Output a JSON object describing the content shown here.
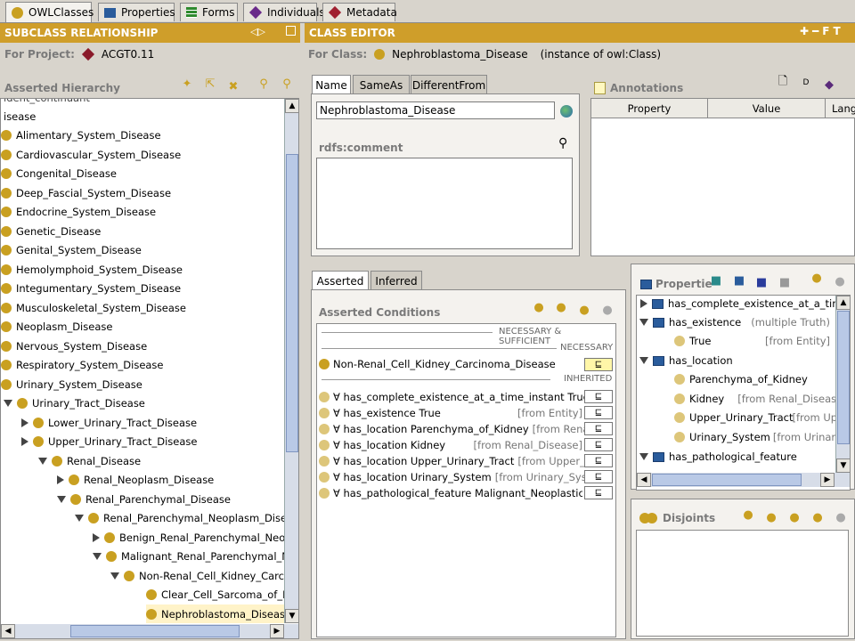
{
  "top_tabs": [
    {
      "label": "OWLClasses",
      "icon": "owl-classes-icon"
    },
    {
      "label": "Properties",
      "icon": "properties-icon"
    },
    {
      "label": "Forms",
      "icon": "forms-icon"
    },
    {
      "label": "Individuals",
      "icon": "individuals-icon"
    },
    {
      "label": "Metadata",
      "icon": "metadata-icon"
    }
  ],
  "left": {
    "header": "SUBCLASS RELATIONSHIP",
    "for_project_label": "For Project:",
    "project_name": "ACGT0.11",
    "hierarchy_label": "Asserted Hierarchy",
    "tree": [
      "isease",
      "Alimentary_System_Disease",
      "Cardiovascular_System_Disease",
      "Congenital_Disease",
      "Deep_Fascial_System_Disease",
      "Endocrine_System_Disease",
      "Genetic_Disease",
      "Genital_System_Disease",
      "Hemolymphoid_System_Disease",
      "Integumentary_System_Disease",
      "Musculoskeletal_System_Disease",
      "Neoplasm_Disease",
      "Nervous_System_Disease",
      "Respiratory_System_Disease",
      "Urinary_System_Disease",
      "Urinary_Tract_Disease",
      "Lower_Urinary_Tract_Disease",
      "Upper_Urinary_Tract_Disease",
      "Renal_Disease",
      "Renal_Neoplasm_Disease",
      "Renal_Parenchymal_Disease",
      "Renal_Parenchymal_Neoplasm_Disease",
      "Benign_Renal_Parenchymal_Neopla",
      "Malignant_Renal_Parenchymal_Neop",
      "Non-Renal_Cell_Kidney_Carcino",
      "Clear_Cell_Sarcoma_of_Kid",
      "Nephroblastoma_Disease"
    ]
  },
  "editor": {
    "header": "CLASS EDITOR",
    "for_class_label": "For Class:",
    "class_name": "Nephroblastoma_Disease",
    "instance_of": "(instance of owl:Class)",
    "name_tabs": [
      "Name",
      "SameAs",
      "DifferentFrom"
    ],
    "name_value": "Nephroblastoma_Disease",
    "rdfs_comment_label": "rdfs:comment",
    "annotations_label": "Annotations",
    "annotation_columns": [
      "Property",
      "Value",
      "Lang"
    ],
    "cond_tabs": [
      "Asserted",
      "Inferred"
    ],
    "asserted_conditions_label": "Asserted Conditions",
    "nec_suff_label": "NECESSARY & SUFFICIENT",
    "necessary_label": "NECESSARY",
    "necessary_item": "Non-Renal_Cell_Kidney_Carcinoma_Disease",
    "inherited_label": "INHERITED",
    "subclass_symbol": "⊑",
    "inherited": [
      {
        "text": "∀ has_complete_existence_at_a_time_instant True",
        "from": ""
      },
      {
        "text": "∀ has_existence True",
        "from": "[from Entity]"
      },
      {
        "text": "∀ has_location Parenchyma_of_Kidney",
        "from": "[from Renal...]"
      },
      {
        "text": "∀ has_location Kidney",
        "from": "[from Renal_Disease]"
      },
      {
        "text": "∀ has_location Upper_Urinary_Tract",
        "from": "[from Upper_Ur...]"
      },
      {
        "text": "∀ has_location Urinary_System",
        "from": "[from Urinary_Syste...]"
      },
      {
        "text": "∀ has_pathological_feature Malignant_Neoplastic_Featur",
        "from": ""
      }
    ],
    "properties_label": "Propertie",
    "properties_tree": [
      {
        "label": "has_complete_existence_at_a_time_i",
        "kind": "prop",
        "expanded": false,
        "note": ""
      },
      {
        "label": "has_existence",
        "kind": "prop",
        "expanded": true,
        "note": "(multiple Truth)"
      },
      {
        "label": "True",
        "kind": "value",
        "note": "[from Entity]"
      },
      {
        "label": "has_location",
        "kind": "prop",
        "expanded": true,
        "note": ""
      },
      {
        "label": "Parenchyma_of_Kidney",
        "kind": "value",
        "note": ""
      },
      {
        "label": "Kidney",
        "kind": "value",
        "note": "[from Renal_Disease]"
      },
      {
        "label": "Upper_Urinary_Tract",
        "kind": "value",
        "note": "[from Uppe...]"
      },
      {
        "label": "Urinary_System",
        "kind": "value",
        "note": "[from Urinary_S...]"
      },
      {
        "label": "has_pathological_feature",
        "kind": "prop",
        "expanded": true,
        "note": ""
      }
    ],
    "disjoints_label": "Disjoints"
  }
}
